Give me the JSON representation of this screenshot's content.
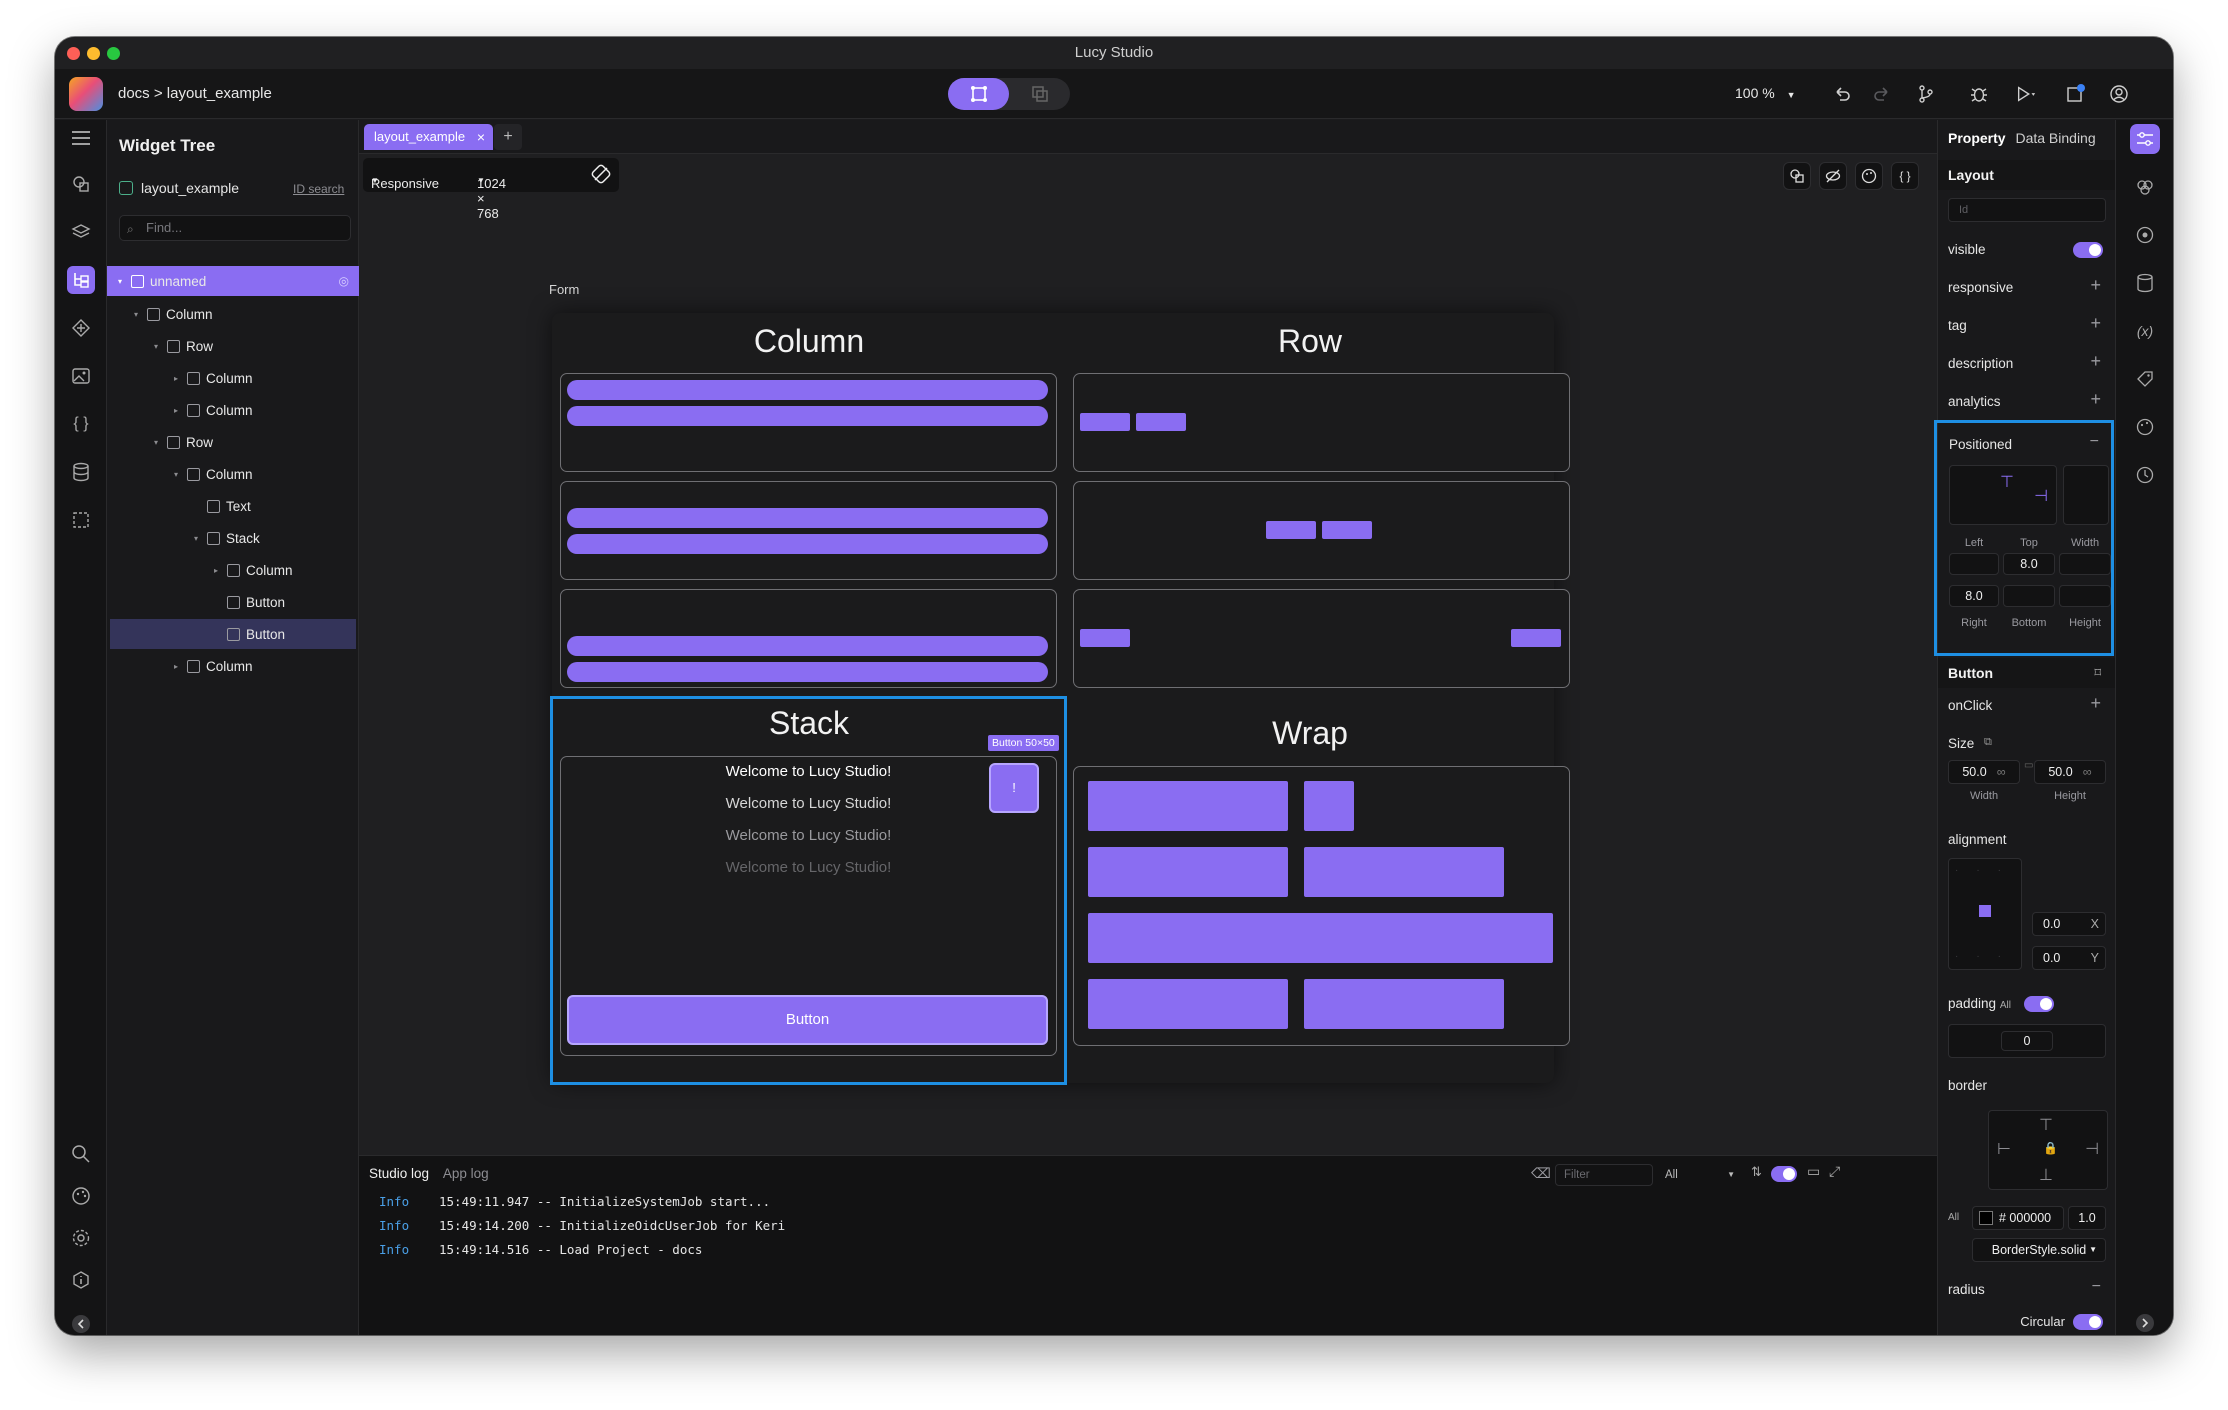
{
  "window": {
    "title": "Lucy Studio"
  },
  "toolbar": {
    "breadcrumb": "docs > layout_example",
    "zoom": "100 %"
  },
  "widget_tree": {
    "title": "Widget Tree",
    "project": "layout_example",
    "id_search": "ID search",
    "find_placeholder": "Find...",
    "nodes": [
      {
        "label": "unnamed"
      },
      {
        "label": "Column"
      },
      {
        "label": "Row"
      },
      {
        "label": "Column"
      },
      {
        "label": "Column"
      },
      {
        "label": "Row"
      },
      {
        "label": "Column"
      },
      {
        "label": "Text"
      },
      {
        "label": "Stack"
      },
      {
        "label": "Column"
      },
      {
        "label": "Button"
      },
      {
        "label": "Button"
      },
      {
        "label": "Column"
      }
    ]
  },
  "editor": {
    "tab_label": "layout_example",
    "device_mode": "Responsive",
    "resolution": "1024 × 768",
    "form_label": "Form",
    "sections": {
      "column": "Column",
      "row": "Row",
      "stack": "Stack",
      "wrap": "Wrap"
    },
    "stack_texts": [
      "Welcome to Lucy Studio!",
      "Welcome to Lucy Studio!",
      "Welcome to Lucy Studio!",
      "Welcome to Lucy Studio!"
    ],
    "stack_button": "Button",
    "selected_badge": "Button  50×50",
    "small_button_glyph": "!"
  },
  "log": {
    "tabs": [
      "Studio log",
      "App log"
    ],
    "filter_placeholder": "Filter",
    "level_select": "All",
    "lines": [
      {
        "level": "Info",
        "text": "15:49:11.947 -- InitializeSystemJob start..."
      },
      {
        "level": "Info",
        "text": "15:49:14.200 -- InitializeOidcUserJob for Keri"
      },
      {
        "level": "Info",
        "text": "15:49:14.516 -- Load Project - docs"
      }
    ]
  },
  "properties": {
    "tabs": [
      "Property",
      "Data Binding"
    ],
    "layout_header": "Layout",
    "id_placeholder": "Id",
    "rows": [
      "visible",
      "responsive",
      "tag",
      "description",
      "analytics"
    ],
    "positioned": {
      "title": "Positioned",
      "labels": [
        "Left",
        "Top",
        "Width",
        "Right",
        "Bottom",
        "Height"
      ],
      "values": {
        "left": "",
        "top": "8.0",
        "width": "",
        "right": "8.0",
        "bottom": "",
        "height": ""
      }
    },
    "button_header": "Button",
    "onclick": "onClick",
    "size_label": "Size",
    "size": {
      "width": "50.0",
      "height": "50.0",
      "width_label": "Width",
      "height_label": "Height"
    },
    "alignment_label": "alignment",
    "alignment": {
      "x": "0.0",
      "y": "0.0",
      "x_label": "X",
      "y_label": "Y"
    },
    "padding_label": "padding",
    "padding_all": "All",
    "padding_value": "0",
    "border_label": "border",
    "border_all": "All",
    "border_color": "# 000000",
    "border_width": "1.0",
    "border_style": "BorderStyle.solid",
    "radius_label": "radius",
    "circular_label": "Circular"
  },
  "colors": {
    "accent": "#8a6df2",
    "selection": "#1e8fe3",
    "log_level": "#4a9fe6"
  }
}
